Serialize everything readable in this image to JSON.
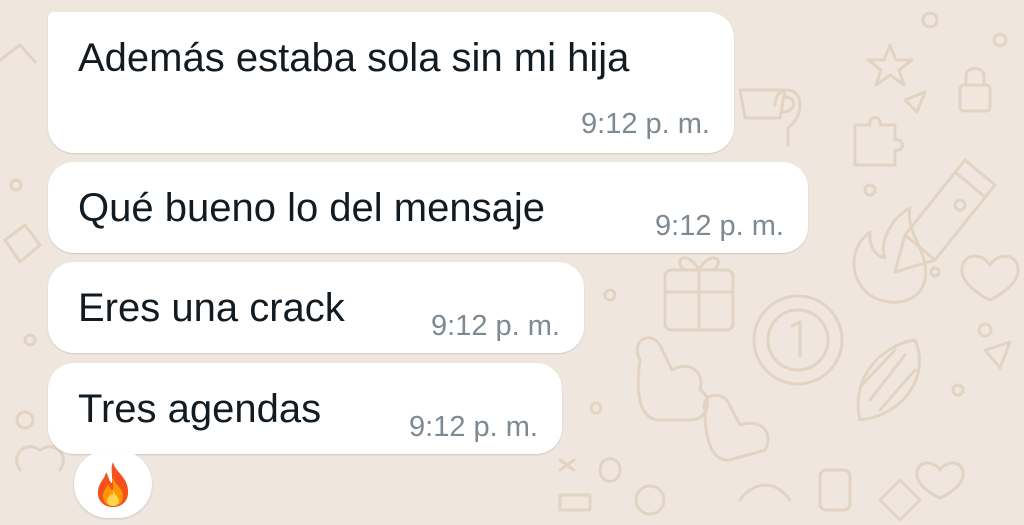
{
  "theme": {
    "wallpaper_color": "#efe7de",
    "doodle_color": "#e2d3c2",
    "bubble_color": "#ffffff",
    "text_color": "#111b21",
    "time_color": "#7d8a92"
  },
  "messages": [
    {
      "text": "Además estaba sola sin mi hija",
      "time": "9:12 p. m."
    },
    {
      "text": "Qué bueno lo del mensaje",
      "time": "9:12 p. m."
    },
    {
      "text": "Eres una crack",
      "time": "9:12 p. m."
    },
    {
      "text": "Tres agendas",
      "time": "9:12 p. m."
    }
  ],
  "reaction": {
    "icon": "fire-emoji-icon"
  }
}
